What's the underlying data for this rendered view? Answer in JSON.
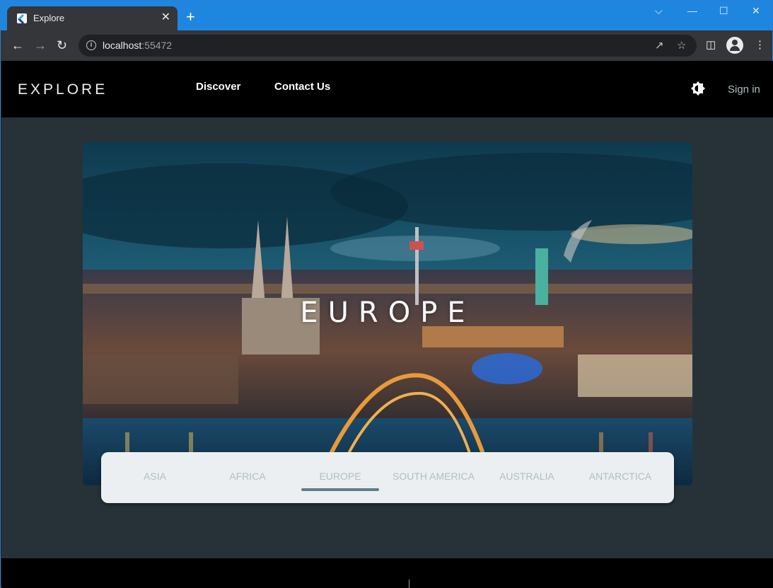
{
  "browser": {
    "tab_title": "Explore",
    "tab_close": "✕",
    "new_tab": "+",
    "url_host": "localhost",
    "url_port": ":55472",
    "window_controls": [
      "⌵",
      "—",
      "☐",
      "✕"
    ]
  },
  "app": {
    "logo": "EXPLORE",
    "nav": [
      "Discover",
      "Contact Us"
    ],
    "theme_toggle_icon": "brightness-icon",
    "signin_label": "Sign in"
  },
  "hero": {
    "title": "EUROPE"
  },
  "regions": {
    "tabs": [
      "ASIA",
      "AFRICA",
      "EUROPE",
      "SOUTH AMERICA",
      "AUSTRALIA",
      "ANTARCTICA"
    ],
    "selected": "EUROPE"
  },
  "colors": {
    "app_background": "#263238",
    "appbar": "#000000",
    "tab_indicator": "#607d8b",
    "tab_inactive_text": "#b0bec5"
  }
}
